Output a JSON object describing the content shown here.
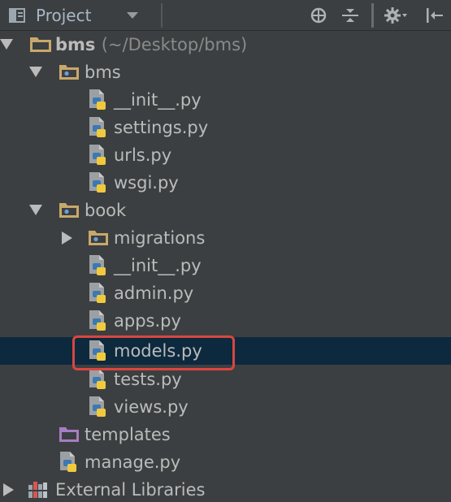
{
  "toolbar": {
    "title": "Project",
    "icons": [
      "project-view-icon",
      "dropdown-caret-icon",
      "locate-icon",
      "collapse-all-icon",
      "gear-icon",
      "hide-panel-icon"
    ]
  },
  "tree": {
    "root": {
      "name": "bms",
      "path": "(~/Desktop/bms)"
    },
    "items": [
      {
        "label": "bms",
        "type": "package"
      },
      {
        "label": "__init__.py",
        "type": "python-file"
      },
      {
        "label": "settings.py",
        "type": "python-file"
      },
      {
        "label": "urls.py",
        "type": "python-file"
      },
      {
        "label": "wsgi.py",
        "type": "python-file"
      },
      {
        "label": "book",
        "type": "package"
      },
      {
        "label": "migrations",
        "type": "package"
      },
      {
        "label": "__init__.py",
        "type": "python-file"
      },
      {
        "label": "admin.py",
        "type": "python-file"
      },
      {
        "label": "apps.py",
        "type": "python-file"
      },
      {
        "label": "models.py",
        "type": "python-file",
        "selected": true
      },
      {
        "label": "tests.py",
        "type": "python-file"
      },
      {
        "label": "views.py",
        "type": "python-file"
      },
      {
        "label": "templates",
        "type": "template-folder"
      },
      {
        "label": "manage.py",
        "type": "python-file"
      },
      {
        "label": "External Libraries",
        "type": "libraries"
      }
    ]
  },
  "colors": {
    "background": "#3c3f41",
    "selection": "#0d293e",
    "highlight_border": "#d9463f",
    "folder": "#c8a86b",
    "template_folder": "#a77dc2",
    "python_blue": "#3b78b5",
    "python_yellow": "#f0c93d"
  }
}
